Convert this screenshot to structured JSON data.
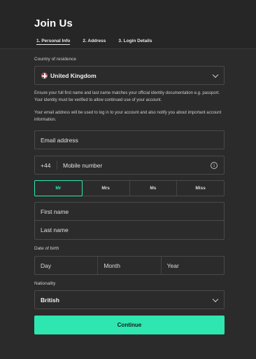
{
  "header": {
    "title": "Join Us",
    "steps": [
      "1. Personal Info",
      "2. Address",
      "3. Login Details"
    ]
  },
  "country": {
    "label": "Country of residence",
    "value": "United Kingdom",
    "flag_icon": "uk-flag-icon"
  },
  "help_text_1": "Ensure your full first name and last name matches your official identity documentation e.g. passport. Your identity must be verified to allow continued use of your account.",
  "help_text_2": "Your email address will be used to log in to your account and also notify you about important account information.",
  "email": {
    "placeholder": "Email address"
  },
  "mobile": {
    "prefix": "+44",
    "placeholder": "Mobile number",
    "icon": "info-icon"
  },
  "titles": {
    "options": [
      "Mr",
      "Mrs",
      "Ms",
      "Miss"
    ],
    "selected": "Mr"
  },
  "first_name": {
    "placeholder": "First name"
  },
  "last_name": {
    "placeholder": "Last name"
  },
  "dob": {
    "label": "Date of birth",
    "day": "Day",
    "month": "Month",
    "year": "Year"
  },
  "nationality": {
    "label": "Nationality",
    "value": "British"
  },
  "continue_label": "Continue",
  "colors": {
    "accent": "#2ee6b0",
    "background": "#2b2b2b",
    "header": "#262626"
  }
}
